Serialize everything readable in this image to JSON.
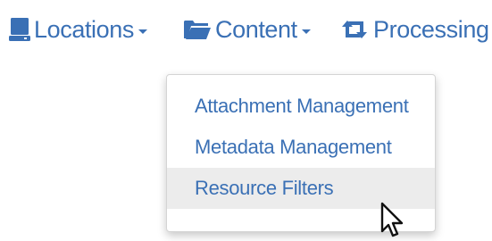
{
  "nav": {
    "items": [
      {
        "label": "Locations",
        "icon": "hard-drive-icon",
        "has_dropdown": true
      },
      {
        "label": "Content",
        "icon": "folder-open-icon",
        "has_dropdown": true
      },
      {
        "label": "Processing",
        "icon": "retweet-icon",
        "has_dropdown": true
      }
    ]
  },
  "dropdown": {
    "parent": "Content",
    "items": [
      {
        "label": "Attachment Management"
      },
      {
        "label": "Metadata Management"
      },
      {
        "label": "Resource Filters",
        "hovered": true
      }
    ]
  },
  "colors": {
    "link": "#3a70b5",
    "hover_bg": "#ececec",
    "border": "#d4d4d4"
  }
}
